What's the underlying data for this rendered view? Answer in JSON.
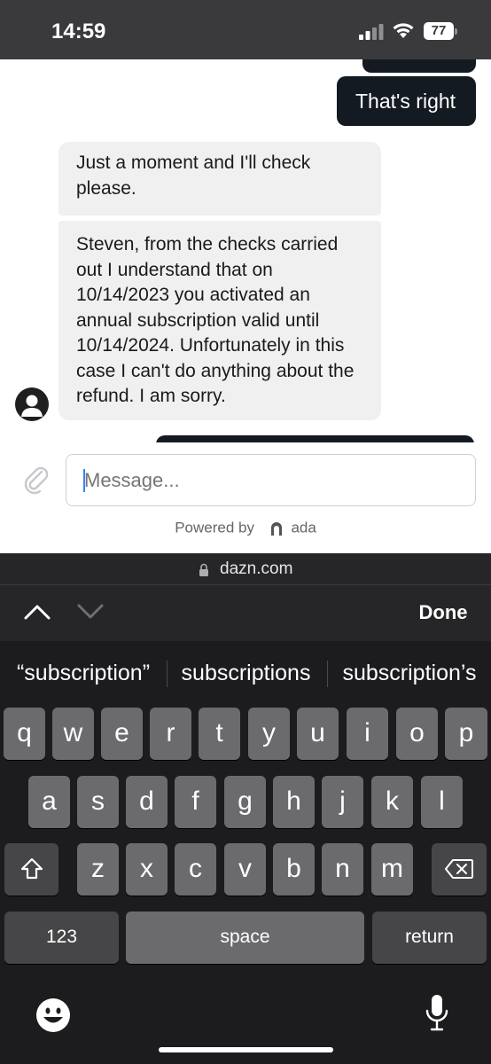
{
  "status_bar": {
    "time": "14:59",
    "battery": "77"
  },
  "chat": {
    "user_message": "That's right",
    "bot_messages": [
      "Just a moment and I'll check please.",
      "Steven, from the checks carried out I understand that on 10/14/2023 you activated an annual subscription valid until 10/14/2024. Unfortunately in this case I can't do anything about the refund. I am sorry."
    ],
    "input_placeholder": "Message...",
    "powered_by": "Powered by",
    "brand": "ada"
  },
  "browser": {
    "url": "dazn.com",
    "done_label": "Done"
  },
  "keyboard": {
    "suggestions": [
      "“subscription”",
      "subscriptions",
      "subscription’s"
    ],
    "row1": [
      "q",
      "w",
      "e",
      "r",
      "t",
      "y",
      "u",
      "i",
      "o",
      "p"
    ],
    "row2": [
      "a",
      "s",
      "d",
      "f",
      "g",
      "h",
      "j",
      "k",
      "l"
    ],
    "row3": [
      "z",
      "x",
      "c",
      "v",
      "b",
      "n",
      "m"
    ],
    "numbers_label": "123",
    "space_label": "space",
    "return_label": "return"
  },
  "icons": [
    "signal-icon",
    "wifi-icon",
    "battery-icon",
    "paperclip-icon",
    "ada-logo-icon",
    "lock-icon",
    "chevron-up-icon",
    "chevron-down-icon",
    "shift-icon",
    "backspace-icon",
    "emoji-icon",
    "microphone-icon",
    "avatar-icon"
  ],
  "colors": {
    "user_bubble": "#141a22",
    "bot_bubble": "#f0f0f0",
    "keyboard": "#1c1c1e",
    "key": "#6b6b6e",
    "caret": "#3b82f6"
  }
}
